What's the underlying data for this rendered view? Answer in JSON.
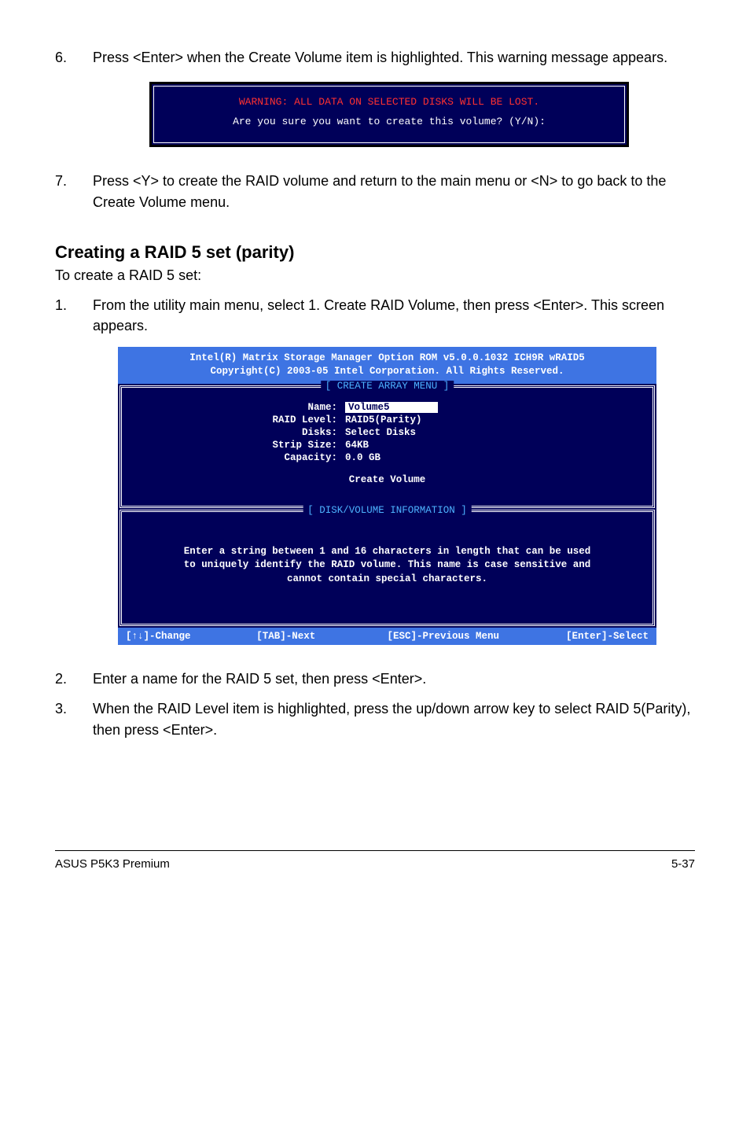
{
  "step6": {
    "num": "6.",
    "text": "Press <Enter> when the Create Volume item is highlighted. This warning message appears."
  },
  "dialog": {
    "warning": "WARNING: ALL DATA ON SELECTED DISKS WILL BE LOST.",
    "prompt": "Are you sure you want to create this volume? (Y/N):"
  },
  "step7": {
    "num": "7.",
    "text": "Press <Y> to create the RAID volume and return to the main menu or <N> to go back to the Create Volume menu."
  },
  "section": {
    "heading": "Creating a RAID 5 set (parity)",
    "intro": "To create a RAID 5 set:"
  },
  "step1": {
    "num": "1.",
    "text": "From the utility main menu, select 1. Create RAID Volume, then press <Enter>. This screen appears."
  },
  "bios": {
    "header_line1": "Intel(R) Matrix Storage Manager Option ROM v5.0.0.1032 ICH9R wRAID5",
    "header_line2": "Copyright(C) 2003-05 Intel Corporation. All Rights Reserved.",
    "panel1_title": "[ CREATE ARRAY MENU ]",
    "fields": {
      "name_label": "Name:",
      "name_value": "Volume5",
      "raid_label": "RAID Level:",
      "raid_value": "RAID5(Parity)",
      "disks_label": "Disks:",
      "disks_value": "Select Disks",
      "strip_label": "Strip Size:",
      "strip_value": "64KB",
      "cap_label": "Capacity:",
      "cap_value": "0.0  GB"
    },
    "create_volume": "Create Volume",
    "panel2_title": "[ DISK/VOLUME INFORMATION ]",
    "info_l1": "Enter a string between 1 and 16 characters in length that can be used",
    "info_l2": "to uniquely identify the RAID volume. This name is case sensitive and",
    "info_l3": "cannot contain special characters.",
    "footer": {
      "change": "[↑↓]-Change",
      "next": "[TAB]-Next",
      "prev": "[ESC]-Previous Menu",
      "select": "[Enter]-Select"
    }
  },
  "step2": {
    "num": "2.",
    "text": "Enter a name for the RAID 5 set, then press <Enter>."
  },
  "step3": {
    "num": "3.",
    "text": "When the RAID Level item is highlighted, press the up/down arrow key to select RAID 5(Parity), then press <Enter>."
  },
  "footer": {
    "left": "ASUS P5K3 Premium",
    "right": "5-37"
  }
}
